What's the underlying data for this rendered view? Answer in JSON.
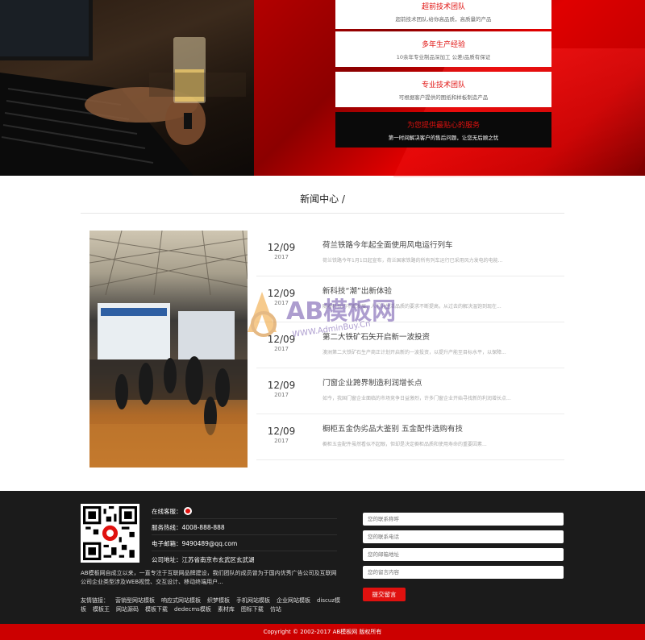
{
  "hero": {
    "cards": [
      {
        "title": "超前技术团队",
        "desc": "超前技术团队,给你高品质，高质量的产品"
      },
      {
        "title": "多年生产经验",
        "desc": "10余年专业制品深加工 公差/品质有保证"
      },
      {
        "title": "专业技术团队",
        "desc": "可根据客户提供的图纸和样板制造产品"
      },
      {
        "title": "为您提供最贴心的服务",
        "desc": "第一时间解决客户的售后问题，让您无后顾之忧"
      }
    ]
  },
  "news": {
    "heading": "新闻中心 /",
    "items": [
      {
        "day": "12/09",
        "year": "2017",
        "title": "荷兰铁路今年起全面使用风电运行列车",
        "desc": "荷兰铁路今年1月1日起宣布，荷兰国家铁路的所有列车运行已采用风力发电的电能..."
      },
      {
        "day": "12/09",
        "year": "2017",
        "title": "新科技“潮”出新体验",
        "desc": "随着科技的不断发展，人们对生活品质的要求不断提高，从过去的解决温饱到现在..."
      },
      {
        "day": "12/09",
        "year": "2017",
        "title": "第二大铁矿石矢开启新一波投资",
        "desc": "澳洲第二大铁矿石生产商正计划开启新的一波投资，以提升产能至目标水平，以保障..."
      },
      {
        "day": "12/09",
        "year": "2017",
        "title": "门窗企业跨界制造利润增长点",
        "desc": "如今，我国门窗企业面临的市场竞争日益激烈，许多门窗企业开始寻找新的利润增长点..."
      },
      {
        "day": "12/09",
        "year": "2017",
        "title": "橱柜五金伪劣品大鉴别 五金配件选购有技",
        "desc": "橱柜五金配件虽然看似不起眼，但却是决定橱柜品质和使用寿命的重要因素..."
      }
    ]
  },
  "watermark": {
    "brand": "AB模板网",
    "url": "WWW.AdminBuy.Cn"
  },
  "footer": {
    "online_label": "在线客服：",
    "hotline": "服务热线：4008-888-888",
    "email": "电子邮箱：9490489@qq.com",
    "address": "公司地址：江苏省南京市玄武区玄武湖",
    "about": "AB模板网自成立以来，一直专注于互联网品牌建设，我们团队的成员曾为于国内优秀广告公司及互联网公司企业类型涉及WEB视觉、交互设计、移动终端用户...",
    "links_label": "友情链接：",
    "links": [
      "营销型网站模板",
      "响应式网站模板",
      "织梦模板",
      "手机网站模板",
      "企业网站模板",
      "discuz模板",
      "模板王",
      "网站源码",
      "模板下载",
      "dedecms模板",
      "素材库",
      "图标下载",
      "仿站"
    ],
    "form": {
      "name_placeholder": "您的联系称呼",
      "phone_placeholder": "您的联系电话",
      "email_placeholder": "您的邮箱地址",
      "message_placeholder": "您的留言内容",
      "submit": "提交留言"
    }
  },
  "copyright": "Copyright © 2002-2017 AB模板网 版权所有",
  "colors": {
    "brand_red": "#e0110f",
    "footer_bg": "#1b1b1b",
    "copyright_bg": "#cc0000"
  }
}
